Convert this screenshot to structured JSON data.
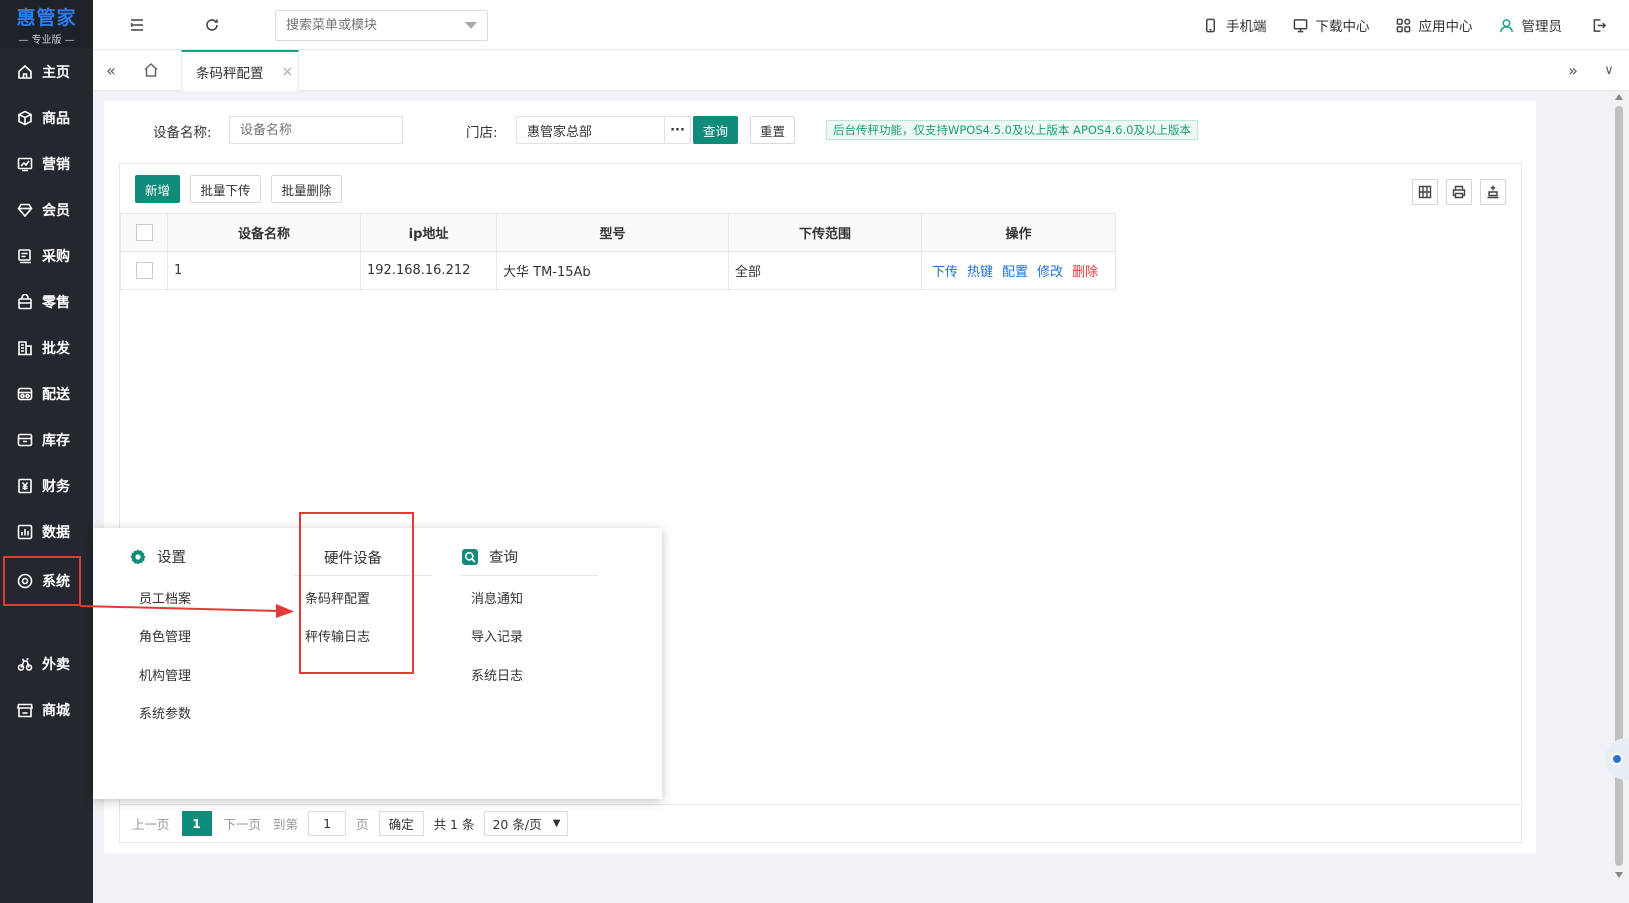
{
  "logo": {
    "main": "惠管家",
    "sub": "— 专业版 —"
  },
  "sidebar": {
    "items": [
      {
        "label": "主页",
        "icon": "home-icon"
      },
      {
        "label": "商品",
        "icon": "box-icon"
      },
      {
        "label": "营销",
        "icon": "chart-icon"
      },
      {
        "label": "会员",
        "icon": "diamond-icon"
      },
      {
        "label": "采购",
        "icon": "receipt-icon"
      },
      {
        "label": "零售",
        "icon": "bag-icon"
      },
      {
        "label": "批发",
        "icon": "building-icon"
      },
      {
        "label": "配送",
        "icon": "truck-icon"
      },
      {
        "label": "库存",
        "icon": "warehouse-icon"
      },
      {
        "label": "财务",
        "icon": "yen-icon"
      },
      {
        "label": "数据",
        "icon": "bar-chart-icon"
      },
      {
        "label": "系统",
        "icon": "settings-icon"
      },
      {
        "label": "外卖",
        "icon": "delivery-icon"
      },
      {
        "label": "商城",
        "icon": "store-icon"
      }
    ]
  },
  "topbar": {
    "search_placeholder": "搜索菜单或模块",
    "links": {
      "mobile": "手机端",
      "download": "下载中心",
      "apps": "应用中心",
      "user": "管理员"
    }
  },
  "tabs": {
    "active": "条码秤配置",
    "close": "×"
  },
  "filter": {
    "device_label": "设备名称:",
    "device_placeholder": "设备名称",
    "store_label": "门店:",
    "store_value": "惠管家总部",
    "dots": "···",
    "query": "查询",
    "reset": "重置",
    "notice": "后台传秤功能，仅支持WPOS4.5.0及以上版本 APOS4.6.0及以上版本"
  },
  "toolbar": {
    "add": "新增",
    "batch_upload": "批量下传",
    "batch_delete": "批量删除"
  },
  "table": {
    "headers": [
      "设备名称",
      "ip地址",
      "型号",
      "下传范围",
      "操作"
    ],
    "rows": [
      {
        "name": "1",
        "ip": "192.168.16.212",
        "model": "大华 TM-15Ab",
        "range": "全部"
      }
    ],
    "ops": {
      "upload": "下传",
      "hotkey": "热键",
      "config": "配置",
      "edit": "修改",
      "delete": "删除"
    }
  },
  "pager": {
    "prev": "上一页",
    "current": "1",
    "next": "下一页",
    "goto": "到第",
    "page_input": "1",
    "page_unit": "页",
    "confirm": "确定",
    "total": "共 1 条",
    "size": "20 条/页"
  },
  "mega": {
    "settings": {
      "title": "设置",
      "items": [
        "员工档案",
        "角色管理",
        "机构管理",
        "系统参数"
      ]
    },
    "hardware": {
      "title": "硬件设备",
      "items": [
        "条码秤配置",
        "秤传输日志"
      ]
    },
    "query": {
      "title": "查询",
      "items": [
        "消息通知",
        "导入记录",
        "系统日志"
      ]
    }
  },
  "colors": {
    "accent": "#128c7a",
    "sidebar": "#23282f",
    "highlight": "#e53935",
    "link": "#1f6fd6"
  }
}
